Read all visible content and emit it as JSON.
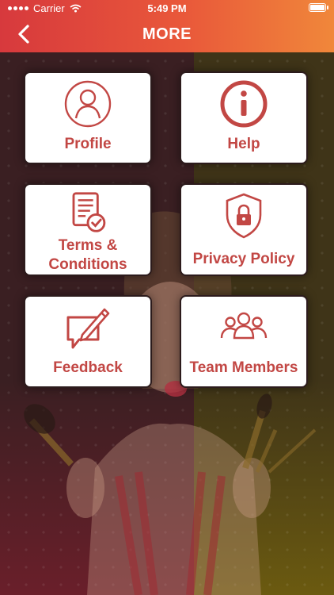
{
  "status_bar": {
    "carrier": "Carrier",
    "time": "5:49 PM",
    "battery_level": 1.0
  },
  "header": {
    "title": "MORE",
    "back_icon": "chevron-left-icon"
  },
  "colors": {
    "header_start": "#d7393d",
    "header_end": "#f0873a",
    "accent": "#c24744",
    "tile_bg": "#ffffff",
    "bg_left": "#3a1f22",
    "bg_right": "#3f3418"
  },
  "menu": {
    "profile": {
      "label": "Profile",
      "icon": "user-icon"
    },
    "help": {
      "label": "Help",
      "icon": "info-icon"
    },
    "terms": {
      "label_line1": "Terms &",
      "label_line2": "Conditions",
      "icon": "document-check-icon"
    },
    "privacy": {
      "label": "Privacy Policy",
      "icon": "shield-lock-icon"
    },
    "feedback": {
      "label": "Feedback",
      "icon": "feedback-pen-icon"
    },
    "team": {
      "label": "Team Members",
      "icon": "group-icon"
    }
  }
}
